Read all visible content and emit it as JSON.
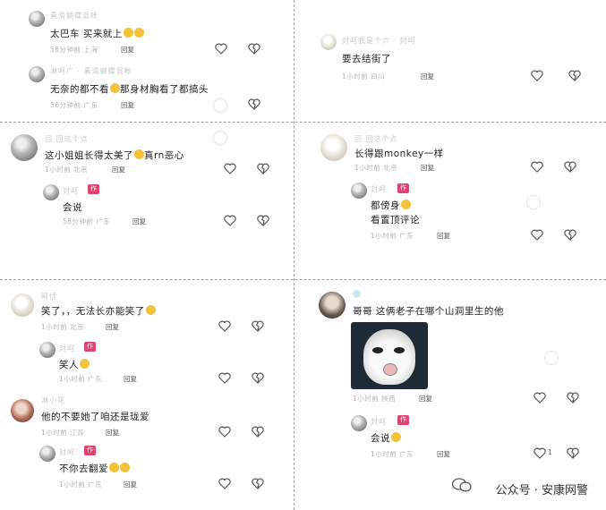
{
  "panels": [
    {
      "comments": [
        {
          "username": "素滑蝴蝶混帐",
          "text": "太巴车 买来就上",
          "meta": "58分钟前 上海",
          "reply": "回复"
        },
        {
          "username": "淋呵广 · 素滑蝴蝶混帐",
          "text": "无奈的都不看",
          "text2": "那身材胸看了都搞头",
          "meta": "56分钟前 广东",
          "reply": "回复"
        }
      ]
    },
    {
      "comments": [
        {
          "username": "封呵我是个六 · 封呵",
          "text": "要去结街了",
          "meta": "1小时前 四川",
          "reply": "回复"
        }
      ]
    },
    {
      "comments": [
        {
          "username": "回 回这个点",
          "text": "这小姐姐长得太美了",
          "text2": "真rn恶心",
          "meta": "1小时前 北京",
          "reply": "回复"
        },
        {
          "username": "封呵",
          "badge": "作者",
          "text": "会说",
          "meta": "58分钟前 广东",
          "reply": "回复"
        }
      ]
    },
    {
      "comments": [
        {
          "username": "回 回这个点",
          "text": "长得跟monkey一样",
          "meta": "1小时前 北京",
          "reply": "回复"
        },
        {
          "username": "封呵",
          "badge": "作者",
          "text": "都傍身",
          "text2": "看置顶评论",
          "meta": "1小时前 广东",
          "reply": "回复"
        }
      ]
    },
    {
      "comments": [
        {
          "username": "阿恬",
          "text": "笑了，，无法长亦能笑了",
          "meta": "1小时前 北京",
          "reply": "回复"
        },
        {
          "username": "封呵",
          "badge": "作者",
          "text": "笑人",
          "meta": "1小时前 广东",
          "reply": "回复"
        },
        {
          "username": "淋小花",
          "text": "他的不要她了咱还是珑爱",
          "meta": "1小时前 江苏",
          "reply": "回复"
        },
        {
          "username": "封呵",
          "badge": "作者",
          "text": "不你去翻爱",
          "meta": "1小时前 广东",
          "reply": "回复"
        }
      ]
    },
    {
      "comments": [
        {
          "username": "",
          "text": "哥哥 这俩老子在哪个山洞里生的他",
          "meta": "1小时前 陕西",
          "reply": "回复"
        },
        {
          "username": "封呵",
          "badge": "作者",
          "text": "会说",
          "meta": "1小时前 广东",
          "reply": "回复",
          "like_count": "1"
        }
      ]
    }
  ],
  "watermark": {
    "text": "公众号 · 安康网警"
  },
  "colors": {
    "badge": "#e0436e",
    "divider": "#9a9a9a"
  }
}
